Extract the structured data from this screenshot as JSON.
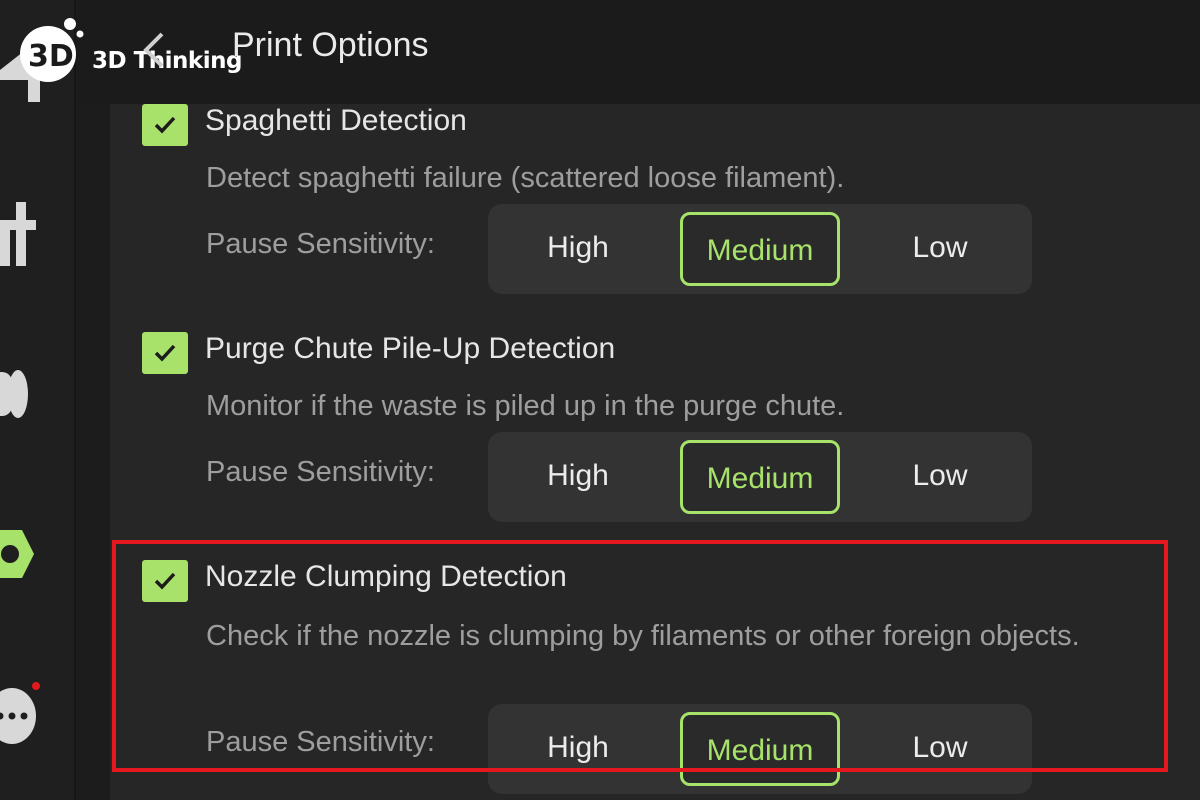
{
  "header": {
    "brand": "3D Thinking",
    "brand_number": "3D",
    "title": "Print Options"
  },
  "sidebar": {
    "icons": [
      "home-icon",
      "tools-icon",
      "camera-icon",
      "settings-hex-icon",
      "chat-icon"
    ],
    "notification": true
  },
  "sections": [
    {
      "checked": true,
      "title": "Spaghetti Detection",
      "description": "Detect spaghetti failure (scattered loose filament).",
      "sensitivity_label": "Pause Sensitivity:",
      "options": [
        "High",
        "Medium",
        "Low"
      ],
      "selected": "Medium"
    },
    {
      "checked": true,
      "title": "Purge Chute Pile-Up Detection",
      "description": "Monitor if the waste is piled up in the purge chute.",
      "sensitivity_label": "Pause Sensitivity:",
      "options": [
        "High",
        "Medium",
        "Low"
      ],
      "selected": "Medium"
    },
    {
      "checked": true,
      "title": "Nozzle Clumping Detection",
      "description": "Check if the nozzle is clumping by filaments or other foreign objects.",
      "sensitivity_label": "Pause Sensitivity:",
      "options": [
        "High",
        "Medium",
        "Low"
      ],
      "selected": "Medium"
    }
  ],
  "colors": {
    "accent": "#a7e36a",
    "highlight": "#e3191f",
    "background": "#1c1c1c",
    "panel": "#262626"
  }
}
